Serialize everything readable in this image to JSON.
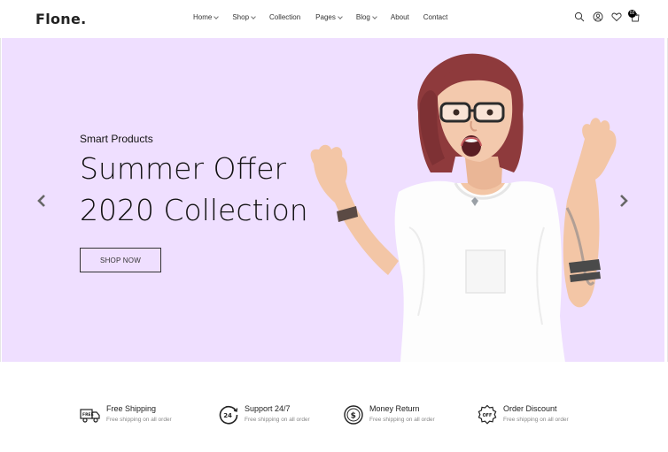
{
  "header": {
    "logo": "Flone.",
    "nav": [
      {
        "label": "Home",
        "dropdown": true
      },
      {
        "label": "Shop",
        "dropdown": true
      },
      {
        "label": "Collection",
        "dropdown": false
      },
      {
        "label": "Pages",
        "dropdown": true
      },
      {
        "label": "Blog",
        "dropdown": true
      },
      {
        "label": "About",
        "dropdown": false
      },
      {
        "label": "Contact",
        "dropdown": false
      }
    ],
    "icons": [
      "search-icon",
      "user-icon",
      "heart-icon",
      "cart-icon"
    ],
    "cart_count": "02"
  },
  "hero": {
    "background": "#efdfff",
    "eyebrow": "Smart Products",
    "title_line1": "Summer Offer",
    "title_line2": "2020 Collection",
    "button_label": "SHOP NOW"
  },
  "features": [
    {
      "icon": "delivery-truck-icon",
      "title": "Free Shipping",
      "subtitle": "Free shipping on all order"
    },
    {
      "icon": "support-24-icon",
      "title": "Support 24/7",
      "subtitle": "Free shipping on all order"
    },
    {
      "icon": "money-return-icon",
      "title": "Money Return",
      "subtitle": "Free shipping on all order"
    },
    {
      "icon": "discount-badge-icon",
      "title": "Order Discount",
      "subtitle": "Free shipping on all order"
    }
  ]
}
